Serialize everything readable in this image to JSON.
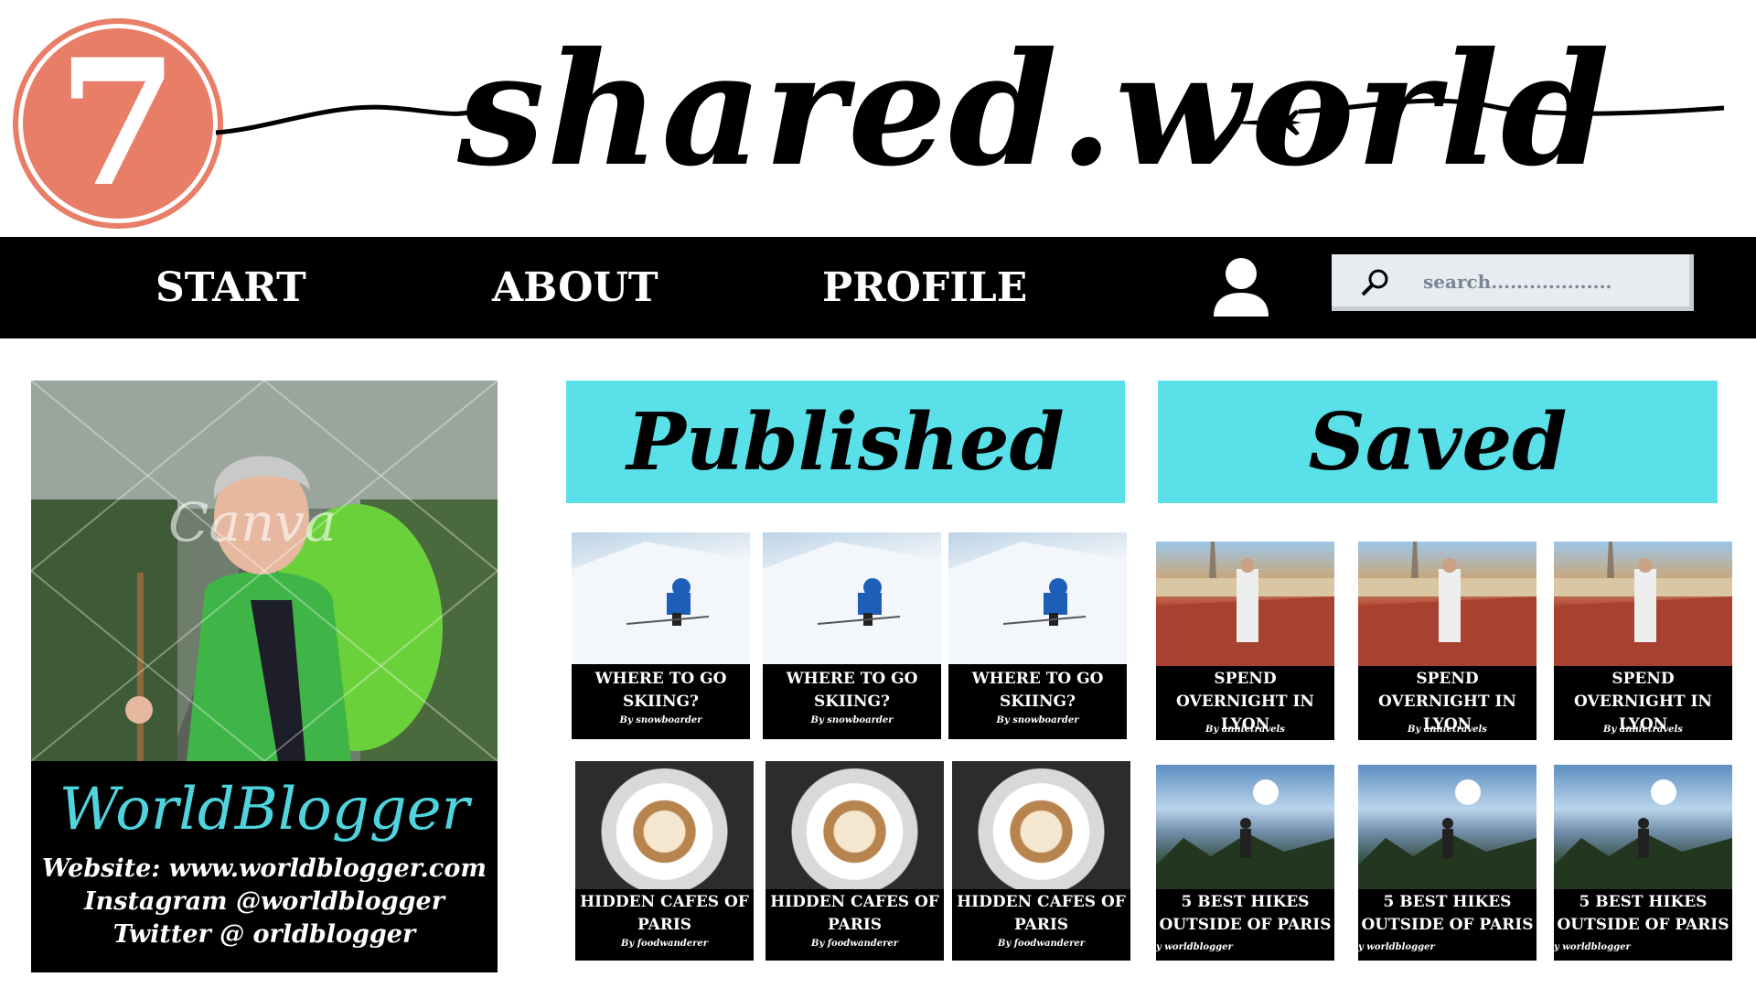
{
  "badge": {
    "number": "7"
  },
  "brand": {
    "title": "shared.world"
  },
  "nav": {
    "links": [
      "START",
      "ABOUT",
      "PROFILE"
    ],
    "search_placeholder": "search..................."
  },
  "profile": {
    "name": "WorldBlogger",
    "website": "Website: www.worldblogger.com",
    "instagram": "Instagram @worldblogger",
    "twitter": "Twitter @ orldblogger",
    "watermark": "Canva"
  },
  "sections": {
    "published": "Published",
    "saved": "Saved"
  },
  "published_posts": [
    {
      "title": "WHERE TO GO SKIING?",
      "author": "By snowboarder"
    },
    {
      "title": "WHERE TO GO SKIING?",
      "author": "By snowboarder"
    },
    {
      "title": "WHERE TO GO SKIING?",
      "author": "By snowboarder"
    },
    {
      "title": "HIDDEN CAFES OF PARIS",
      "author": "By foodwanderer"
    },
    {
      "title": "HIDDEN CAFES OF PARIS",
      "author": "By foodwanderer"
    },
    {
      "title": "HIDDEN CAFES OF PARIS",
      "author": "By foodwanderer"
    }
  ],
  "saved_posts": [
    {
      "title": "SPEND OVERNIGHT IN LYON",
      "author": "By annietravels"
    },
    {
      "title": "SPEND OVERNIGHT IN LYON",
      "author": "By annietravels"
    },
    {
      "title": "SPEND OVERNIGHT IN LYON",
      "author": "By annietravels"
    },
    {
      "title": "5 BEST HIKES OUTSIDE OF PARIS",
      "author": "y worldblogger"
    },
    {
      "title": "5 BEST HIKES OUTSIDE OF PARIS",
      "author": "y worldblogger"
    },
    {
      "title": "5 BEST HIKES OUTSIDE OF PARIS",
      "author": "y worldblogger"
    }
  ],
  "colors": {
    "accent_cyan": "#5ae0e8",
    "badge_coral": "#e87e68",
    "name_cyan": "#4fd4de",
    "nav_black": "#000000"
  }
}
